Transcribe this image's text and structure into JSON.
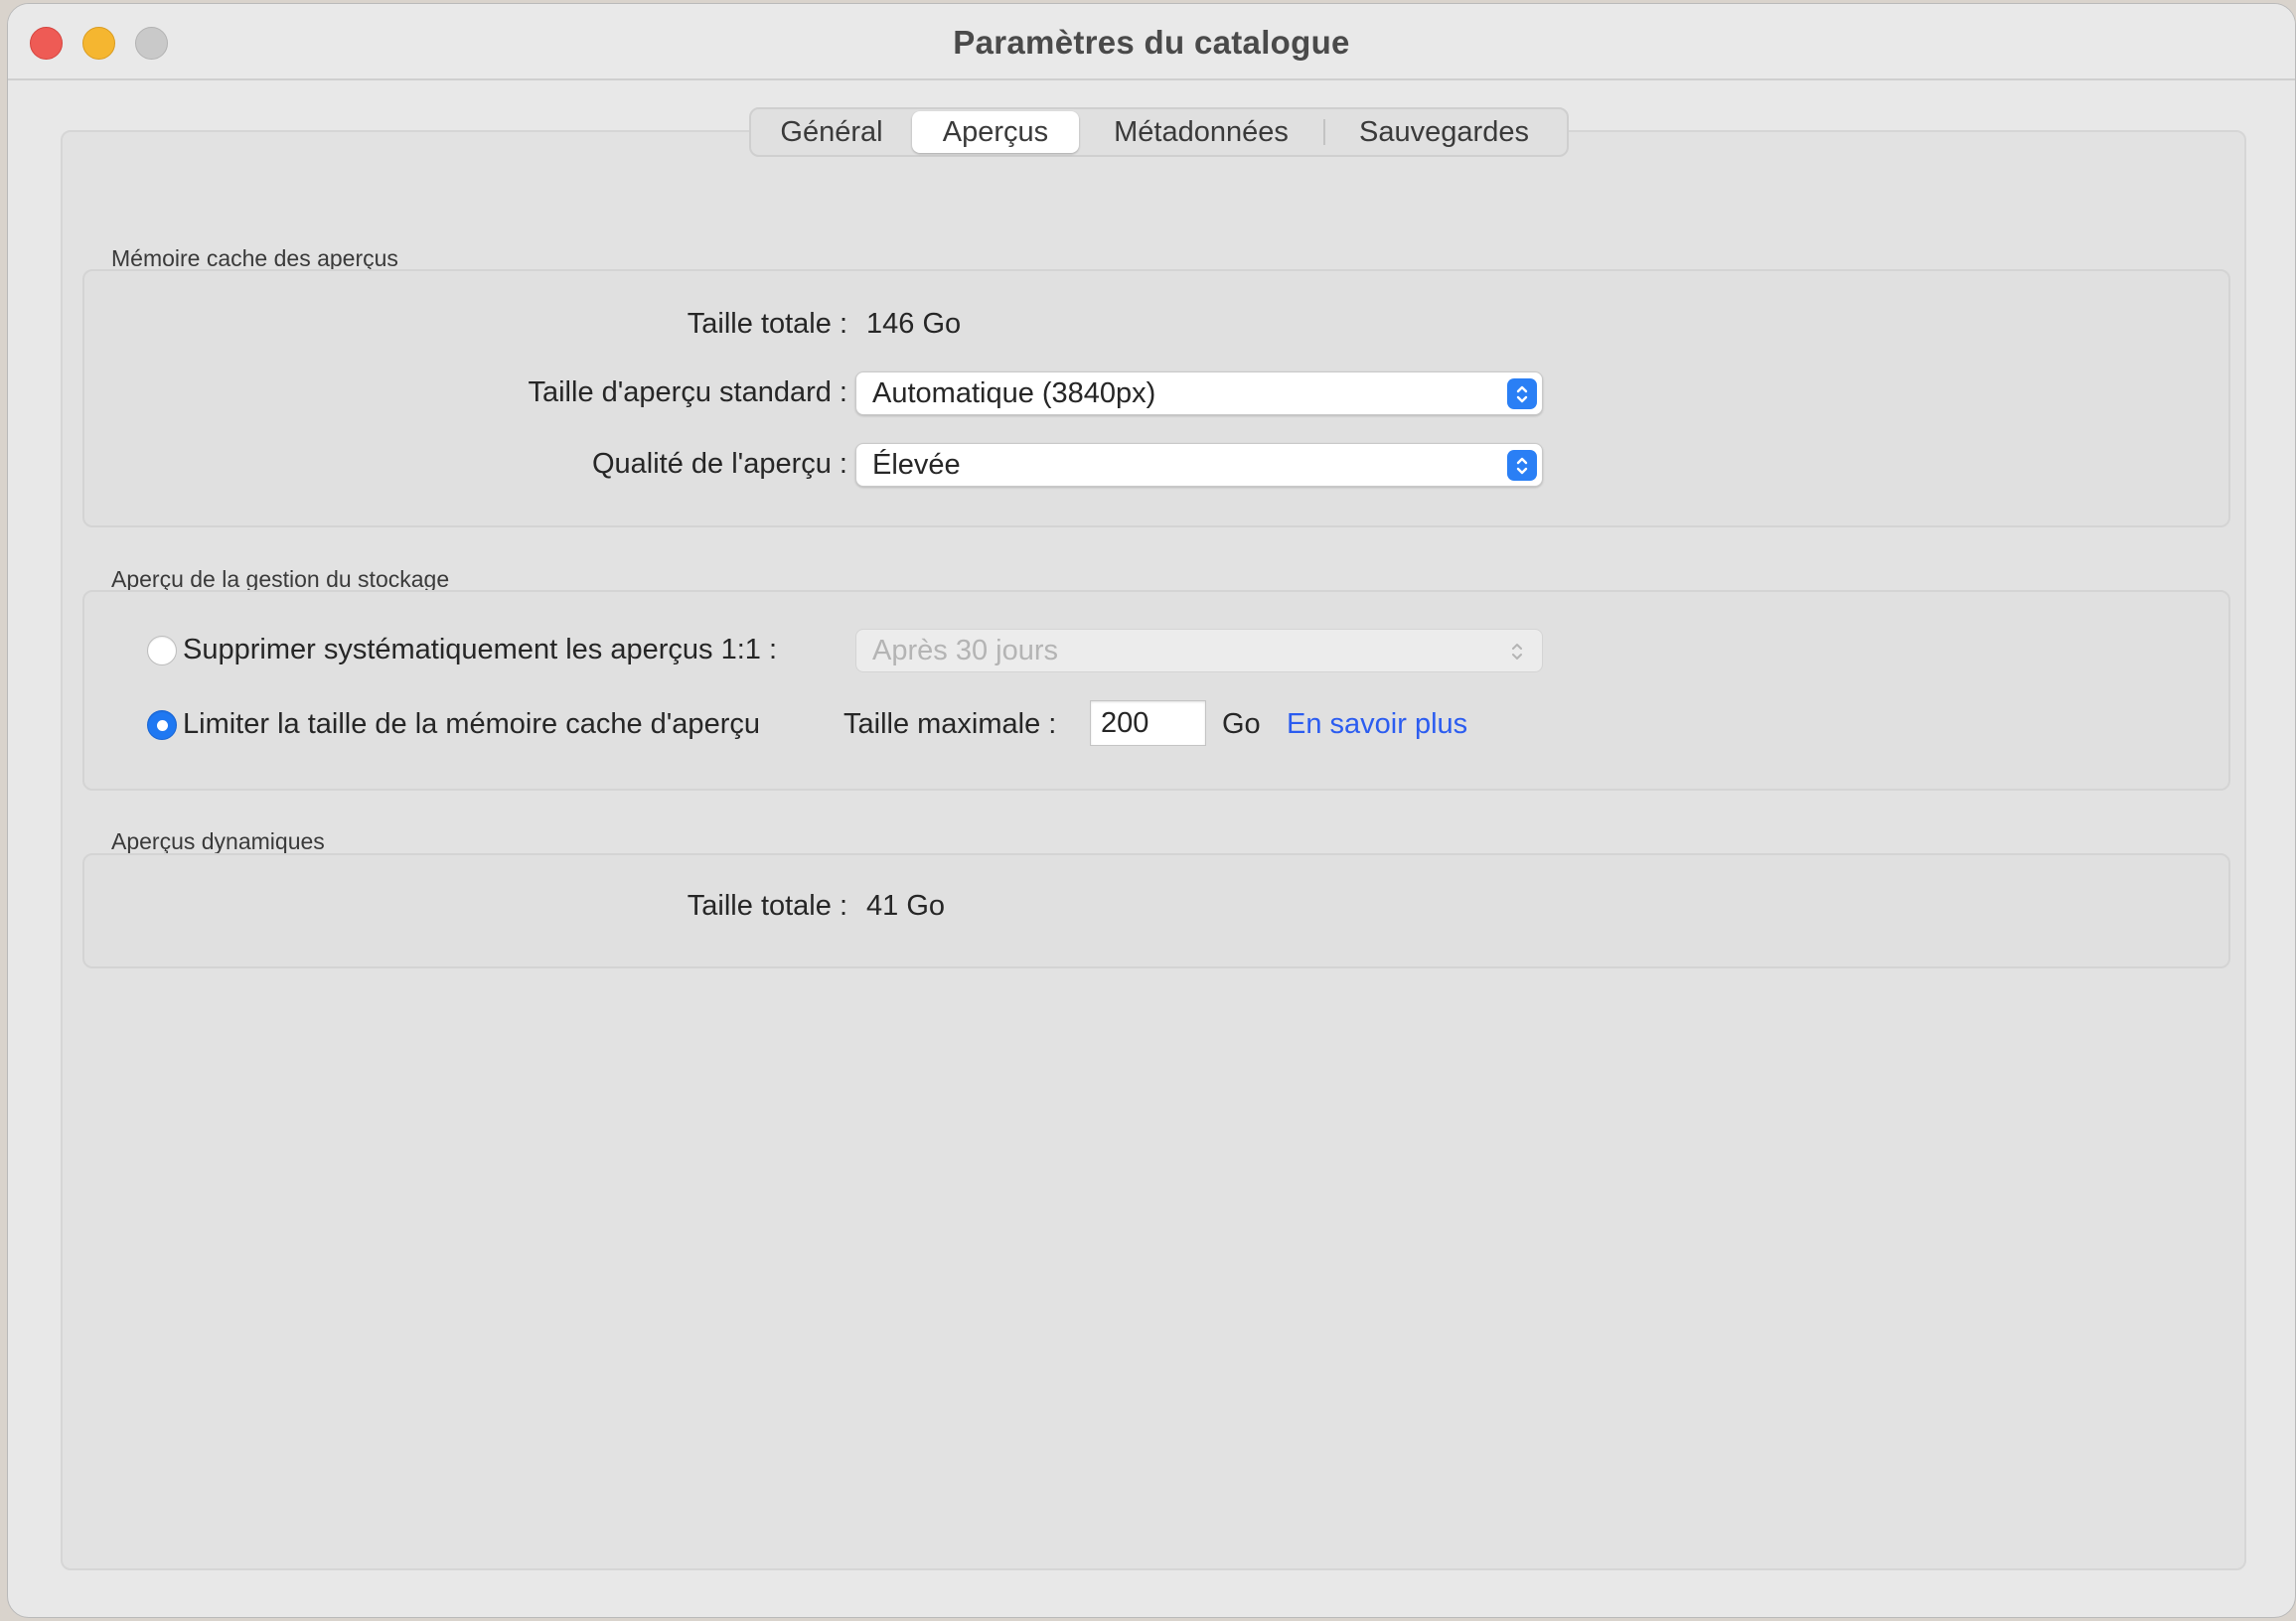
{
  "window": {
    "title": "Paramètres du catalogue"
  },
  "tabs": [
    {
      "label": "Général",
      "active": false
    },
    {
      "label": "Aperçus",
      "active": true
    },
    {
      "label": "Métadonnées",
      "active": false
    },
    {
      "label": "Sauvegardes",
      "active": false
    }
  ],
  "cache": {
    "heading": "Mémoire cache des aperçus",
    "total_label": "Taille totale :",
    "total_value": "146 Go",
    "std_size_label": "Taille d'aperçu standard :",
    "std_size_value": "Automatique (3840px)",
    "quality_label": "Qualité de l'aperçu :",
    "quality_value": "Élevée"
  },
  "storage": {
    "heading": "Aperçu de la gestion du stockage",
    "delete_label": "Supprimer systématiquement les aperçus 1:1 :",
    "delete_selected": false,
    "delete_value": "Après 30 jours",
    "limit_label": "Limiter la taille de la mémoire cache d'aperçu",
    "limit_selected": true,
    "max_label": "Taille maximale :",
    "max_value": "200",
    "unit": "Go",
    "learn_more": "En savoir plus"
  },
  "dynamic": {
    "heading": "Aperçus dynamiques",
    "total_label": "Taille totale :",
    "total_value": "41 Go"
  },
  "colors": {
    "accent": "#1f78f2",
    "link": "#2b5cf0",
    "close": "#ee5b55",
    "minimize": "#f5b630",
    "zoom_disabled": "#c9c9c9"
  }
}
